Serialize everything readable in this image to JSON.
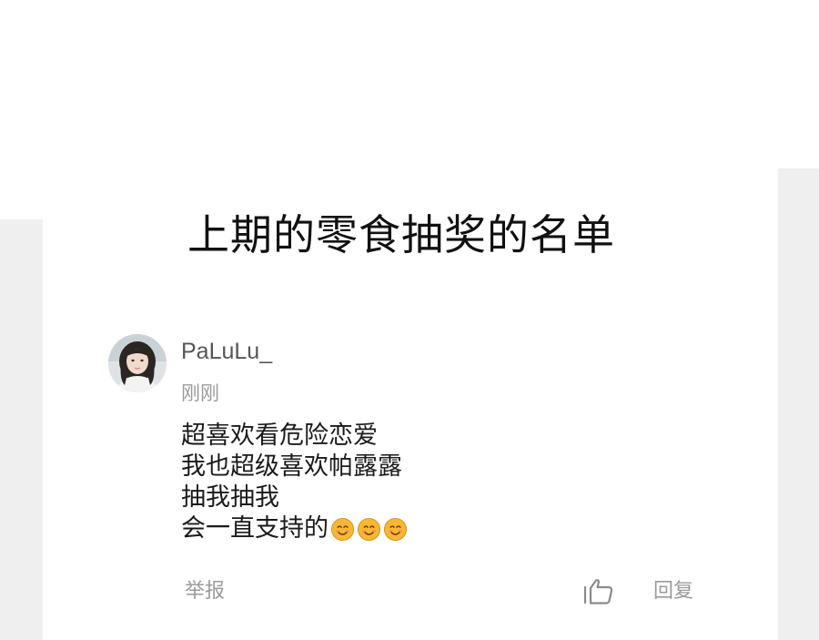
{
  "post": {
    "title": "上期的零食抽奖的名单"
  },
  "comment": {
    "user": {
      "name": "PaLuLu_",
      "avatar_icon": "avatar-photo"
    },
    "timestamp": "刚刚",
    "lines": [
      "超喜欢看危险恋爱",
      "我也超级喜欢帕露露",
      "抽我抽我",
      "会一直支持的"
    ],
    "emojis": [
      "smiling-face-emoji",
      "smiling-face-emoji",
      "smiling-face-emoji"
    ],
    "actions": {
      "report_label": "举报",
      "like_icon": "thumbs-up-icon",
      "reply_label": "回复"
    }
  },
  "colors": {
    "background": "#ffffff",
    "side_gray": "#efefef",
    "title_text": "#111111",
    "username_text": "#555555",
    "muted_text": "#9a9a9a",
    "comment_text": "#1a1a1a",
    "emoji_face": "#f7b733"
  }
}
